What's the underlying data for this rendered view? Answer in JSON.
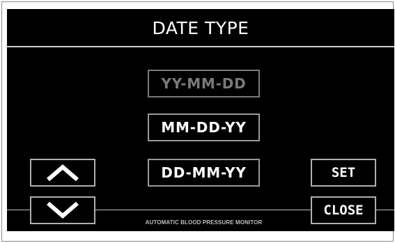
{
  "screen": {
    "title": "DATE TYPE",
    "footer_text": "AUTOMATIC BLOOD PRESSURE MONITOR"
  },
  "options": [
    {
      "label": "YY-MM-DD",
      "state": "disabled"
    },
    {
      "label": "MM-DD-YY",
      "state": "enabled"
    },
    {
      "label": "DD-MM-YY",
      "state": "enabled"
    }
  ],
  "buttons": {
    "up_icon": "chevron-up-icon",
    "down_icon": "chevron-down-icon",
    "set_label": "SET",
    "close_label": "CLOSE"
  },
  "colors": {
    "screen_background": "#000000",
    "text": "#ffffff",
    "border": "#9a9a9a",
    "disabled_text": "#7a7a7a"
  }
}
